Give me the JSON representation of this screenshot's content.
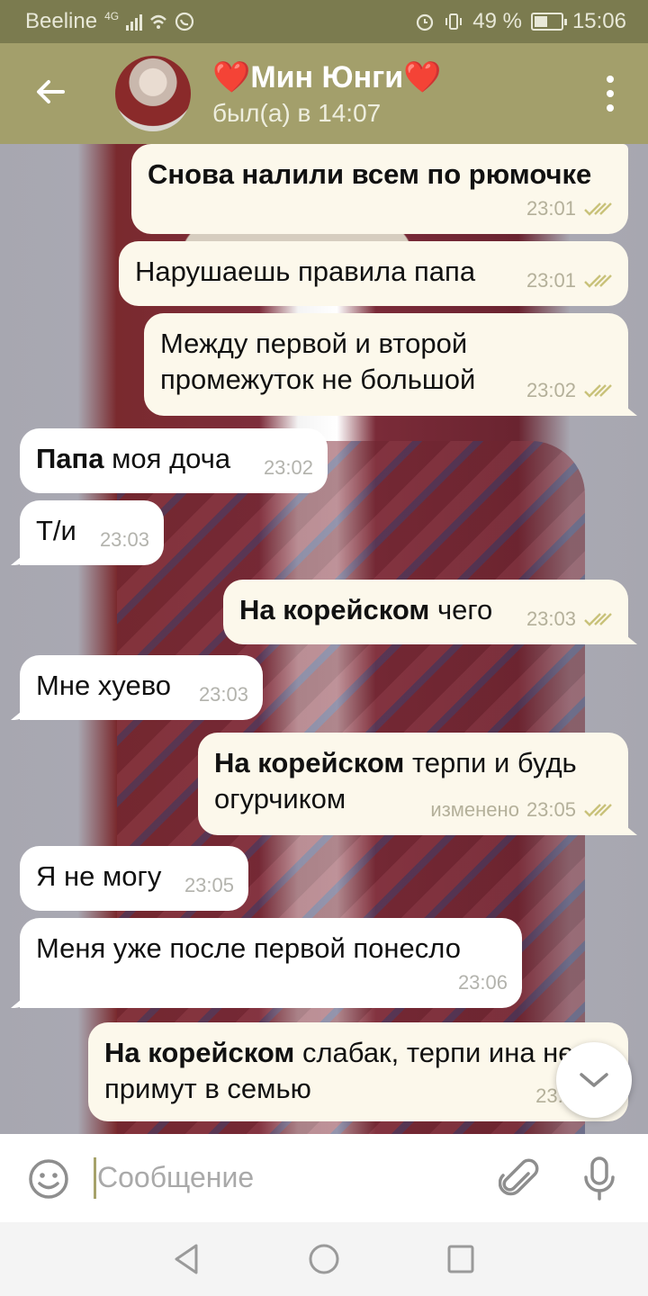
{
  "status_bar": {
    "carrier": "Beeline",
    "network": "4G",
    "battery_percent": "49 %",
    "battery_level": 0.49,
    "time": "15:06"
  },
  "header": {
    "contact_name": "❤️Мин Юнги❤️",
    "last_seen": "был(а) в 14:07"
  },
  "messages": [
    {
      "dir": "out",
      "bold": "Снова налили всем по рюмочке",
      "text": "",
      "time": "23:01",
      "edited": ""
    },
    {
      "dir": "out",
      "bold": "",
      "text": "Нарушаешь правила папа",
      "time": "23:01",
      "edited": ""
    },
    {
      "dir": "out",
      "bold": "",
      "text": "Между первой и второй промежуток не большой",
      "time": "23:02",
      "edited": ""
    },
    {
      "dir": "in",
      "bold": "Папа",
      "text": " моя доча",
      "time": "23:02",
      "edited": ""
    },
    {
      "dir": "in",
      "bold": "",
      "text": "Т/и",
      "time": "23:03",
      "edited": ""
    },
    {
      "dir": "out",
      "bold": "На корейском",
      "text": " чего",
      "time": "23:03",
      "edited": ""
    },
    {
      "dir": "in",
      "bold": "",
      "text": "Мне хуево",
      "time": "23:03",
      "edited": ""
    },
    {
      "dir": "out",
      "bold": "На корейском",
      "text": " терпи и будь огурчиком",
      "time": "23:05",
      "edited": "изменено"
    },
    {
      "dir": "in",
      "bold": "",
      "text": "Я не могу",
      "time": "23:05",
      "edited": ""
    },
    {
      "dir": "in",
      "bold": "",
      "text": "Меня уже после первой понесло",
      "time": "23:06",
      "edited": ""
    },
    {
      "dir": "out",
      "bold": "На корейском",
      "text": " слабак, терпи ина не примут в семью",
      "time": "23:0",
      "edited": ""
    }
  ],
  "input": {
    "placeholder": "Сообщение"
  },
  "icons": {
    "back": "back-arrow-icon",
    "menu": "more-vert-icon",
    "emoji": "smiley-icon",
    "attach": "paperclip-icon",
    "mic": "microphone-icon",
    "scroll": "chevron-down-icon",
    "read": "double-check-icon"
  },
  "colors": {
    "header": "#a39f6b",
    "status_bar": "#7b7b4f",
    "outgoing_bubble": "#fcf8eb",
    "incoming_bubble": "#ffffff",
    "check": "#c9c27a"
  }
}
